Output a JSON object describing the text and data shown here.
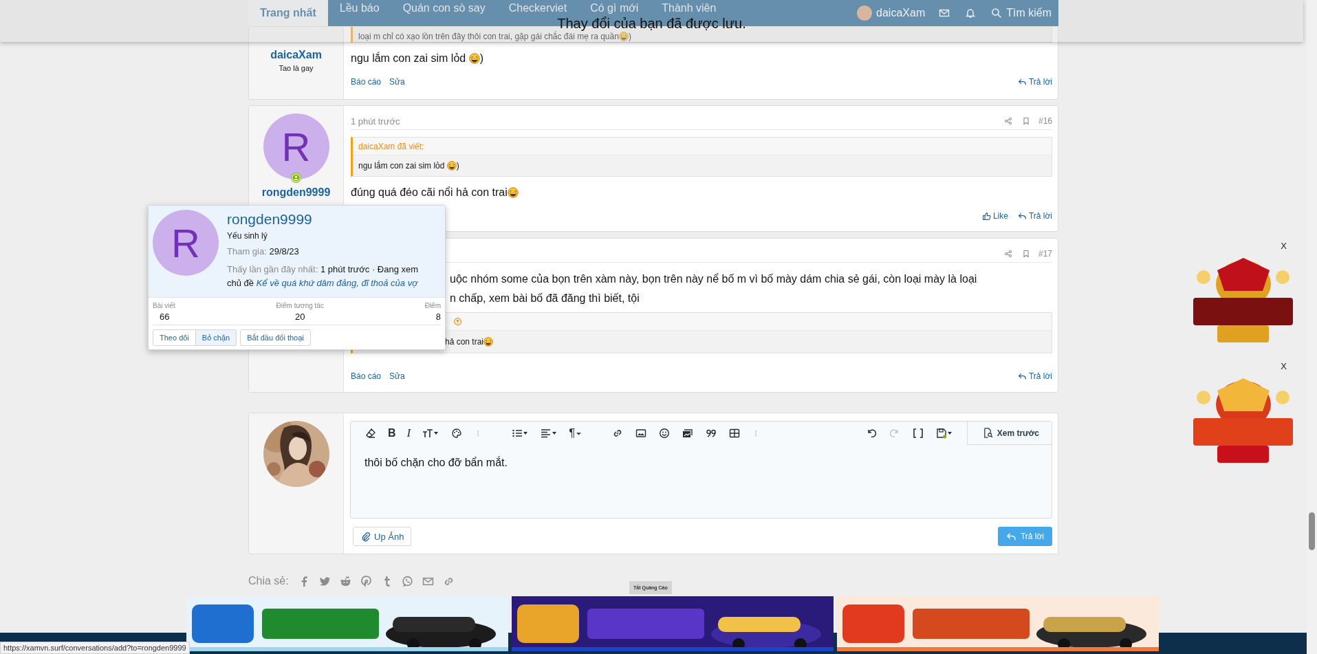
{
  "toast": {
    "message": "Thay đổi của bạn đã được lưu."
  },
  "nav": {
    "items": [
      {
        "label": "Trang nhất",
        "selected": true
      },
      {
        "label": "Lều báo",
        "selected": false
      },
      {
        "label": "Quán con sò say",
        "selected": false
      },
      {
        "label": "Checkerviet",
        "selected": false
      },
      {
        "label": "Có gì mới",
        "selected": false
      },
      {
        "label": "Thành viên",
        "selected": false
      }
    ],
    "user": "daicaXam",
    "search": "Tìm kiếm"
  },
  "posts": [
    {
      "author": "daicaXam",
      "user_title": "Tao là gay",
      "quote": {
        "content": [
          {
            "kind": "text",
            "text": "loại m chỉ có xạo lồn trên đây thôi con trai, gặp gái chắc đái mẹ ra quần"
          },
          {
            "kind": "emoji"
          },
          {
            "kind": "text",
            "text": ")"
          }
        ]
      },
      "message": [
        [
          {
            "kind": "text",
            "text": "ngu lắm con zai sim lỏd "
          },
          {
            "kind": "emoji"
          },
          {
            "kind": "text",
            "text": ")"
          }
        ]
      ],
      "actions_left": [
        "Báo cáo",
        "Sửa"
      ],
      "actions_right": [
        {
          "kind": "reply",
          "label": "Trả lời"
        }
      ]
    },
    {
      "author": "rongden9999",
      "avatar_letter": "R",
      "online": true,
      "time": "1 phút trước",
      "number": "#16",
      "quote_after_message": false,
      "quote": {
        "author_line": "daicaXam đã viết:",
        "content": [
          {
            "kind": "text",
            "text": "ngu lắm con zai sim lỏd "
          },
          {
            "kind": "emoji"
          },
          {
            "kind": "text",
            "text": ")"
          }
        ]
      },
      "message": [
        [
          {
            "kind": "text",
            "text": "đúng quá đéo cãi nổi hả con trai"
          },
          {
            "kind": "emoji"
          }
        ]
      ],
      "actions_right": [
        {
          "kind": "like",
          "label": "Like"
        },
        {
          "kind": "reply",
          "label": "Trả lời"
        }
      ]
    },
    {
      "number": "#17",
      "quote_after_message": true,
      "quote": {
        "arrow": true,
        "content": [
          {
            "kind": "text",
            "text": "hả con trai"
          },
          {
            "kind": "emoji"
          }
        ]
      },
      "message": [
        [
          {
            "kind": "text",
            "text": "uộc nhóm some của bọn trên xàm này, bọn trên này nể bố m vì bố mày dám chia sẻ gái, còn loại mày là loại"
          }
        ],
        [
          {
            "kind": "text",
            "text": "n chấp, xem bài bố đã đăng thì biết, tội"
          }
        ]
      ],
      "actions_left": [
        "Báo cáo",
        "Sửa"
      ],
      "actions_right": [
        {
          "kind": "reply",
          "label": "Trả lời"
        }
      ]
    }
  ],
  "popup": {
    "name": "rongden9999",
    "avatar_letter": "R",
    "user_title": "Yếu sinh lý",
    "joined_label": "Tham gia:",
    "joined": "29/8/23",
    "seen_label": "Thấy lần gần đây nhất:",
    "seen_text": "1 phút trước · Đang xem chủ đề",
    "seen_link": "Kể về quá khứ dâm đảng, đĩ thoả của vợ",
    "stats": [
      {
        "label": "Bài viết",
        "value": "66"
      },
      {
        "label": "Điểm tương tác",
        "value": "20"
      },
      {
        "label": "Điểm",
        "value": "8"
      }
    ],
    "buttons": [
      {
        "label": "Theo dõi",
        "highlighted": false
      },
      {
        "label": "Bỏ chặn",
        "highlighted": true
      }
    ],
    "conversation_button": "Bắt đầu đối thoại"
  },
  "editor": {
    "bold": "B",
    "italic": "I",
    "paragraph": "¶",
    "preview": "Xem trước",
    "text": "thôi bố chặn cho đỡ bẩn mắt.",
    "attach": "Up Ảnh",
    "submit": "Trả lời"
  },
  "share": {
    "label": "Chia sẻ:"
  },
  "ads": {
    "toggle": "Tắt Quảng Cáo",
    "side": [
      {
        "close": "X",
        "kind": "picture"
      },
      {
        "close": "X",
        "kind": "picture"
      }
    ]
  },
  "status_url": "https://xamvn.surf/conversations/add?to=rongden9999"
}
